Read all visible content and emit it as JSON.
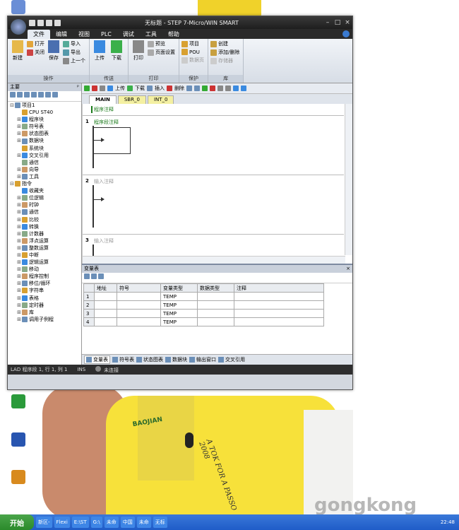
{
  "window": {
    "title": "无标题 - STEP 7-Micro/WIN SMART"
  },
  "menu": [
    "文件",
    "编辑",
    "视图",
    "PLC",
    "调试",
    "工具",
    "帮助"
  ],
  "ribbon": {
    "groups": [
      {
        "label": "操作",
        "big": [
          {
            "label": "新建",
            "icon": "new-icon"
          }
        ],
        "small": [
          {
            "label": "打开"
          },
          {
            "label": "关闭"
          }
        ],
        "big2": [
          {
            "label": "保存"
          }
        ],
        "small2": [
          {
            "label": "导入"
          },
          {
            "label": "导出"
          },
          {
            "label": "上一个"
          }
        ]
      },
      {
        "label": "传送",
        "big": [
          {
            "label": "上传"
          },
          {
            "label": "下载"
          }
        ]
      },
      {
        "label": "打印",
        "big": [
          {
            "label": "打印"
          }
        ],
        "small": [
          {
            "label": "预览"
          },
          {
            "label": "页面设置"
          }
        ]
      },
      {
        "label": "保护",
        "small": [
          {
            "label": "项目"
          },
          {
            "label": "POU"
          },
          {
            "label": "数据页"
          }
        ]
      },
      {
        "label": "库",
        "small": [
          {
            "label": "创建"
          },
          {
            "label": "添加/删除"
          },
          {
            "label": "存储器"
          }
        ]
      }
    ]
  },
  "nav": {
    "title": "主要",
    "tree": [
      {
        "label": "项目1",
        "level": 0,
        "exp": "-"
      },
      {
        "label": "CPU ST40",
        "level": 1,
        "exp": ""
      },
      {
        "label": "程序块",
        "level": 1,
        "exp": "+"
      },
      {
        "label": "符号表",
        "level": 1,
        "exp": "+"
      },
      {
        "label": "状态图表",
        "level": 1,
        "exp": "+"
      },
      {
        "label": "数据块",
        "level": 1,
        "exp": "+"
      },
      {
        "label": "系统块",
        "level": 1,
        "exp": ""
      },
      {
        "label": "交叉引用",
        "level": 1,
        "exp": "+"
      },
      {
        "label": "通信",
        "level": 1,
        "exp": ""
      },
      {
        "label": "向导",
        "level": 1,
        "exp": "+"
      },
      {
        "label": "工具",
        "level": 1,
        "exp": "+"
      },
      {
        "label": "指令",
        "level": 0,
        "exp": "-"
      },
      {
        "label": "收藏夹",
        "level": 1,
        "exp": ""
      },
      {
        "label": "位逻辑",
        "level": 1,
        "exp": "+"
      },
      {
        "label": "时钟",
        "level": 1,
        "exp": "+"
      },
      {
        "label": "通信",
        "level": 1,
        "exp": "+"
      },
      {
        "label": "比较",
        "level": 1,
        "exp": "+"
      },
      {
        "label": "转换",
        "level": 1,
        "exp": "+"
      },
      {
        "label": "计数器",
        "level": 1,
        "exp": "+"
      },
      {
        "label": "浮点运算",
        "level": 1,
        "exp": "+"
      },
      {
        "label": "整数运算",
        "level": 1,
        "exp": "+"
      },
      {
        "label": "中断",
        "level": 1,
        "exp": "+"
      },
      {
        "label": "逻辑运算",
        "level": 1,
        "exp": "+"
      },
      {
        "label": "移动",
        "level": 1,
        "exp": "+"
      },
      {
        "label": "程序控制",
        "level": 1,
        "exp": "+"
      },
      {
        "label": "移位/循环",
        "level": 1,
        "exp": "+"
      },
      {
        "label": "字符串",
        "level": 1,
        "exp": "+"
      },
      {
        "label": "表格",
        "level": 1,
        "exp": "+"
      },
      {
        "label": "定时器",
        "level": 1,
        "exp": "+"
      },
      {
        "label": "库",
        "level": 1,
        "exp": "+"
      },
      {
        "label": "调用子例程",
        "level": 1,
        "exp": "+"
      }
    ]
  },
  "editor": {
    "toolbar": [
      "上传",
      "下载",
      "插入",
      "删除"
    ],
    "tabs": [
      "MAIN",
      "SBR_0",
      "INT_0"
    ],
    "program_comment": "程序注释",
    "networks": [
      {
        "num": "1",
        "comment": "程序段注释"
      },
      {
        "num": "2",
        "comment": "输入注释"
      },
      {
        "num": "3",
        "comment": "输入注释"
      }
    ]
  },
  "vartable": {
    "title": "变量表",
    "headers": [
      "地址",
      "符号",
      "变量类型",
      "数据类型",
      "注释"
    ],
    "rows": [
      {
        "n": "1",
        "type": "TEMP"
      },
      {
        "n": "2",
        "type": "TEMP"
      },
      {
        "n": "3",
        "type": "TEMP"
      },
      {
        "n": "4",
        "type": "TEMP"
      }
    ],
    "bottom_tabs": [
      "变量表",
      "符号表",
      "状态图表",
      "数据块",
      "输出窗口",
      "交叉引用"
    ]
  },
  "status": {
    "pos": "LAD 程序段 1, 行 1, 列 1",
    "mode": "INS",
    "conn": "未连接"
  },
  "taskbar": {
    "start": "开始",
    "items": [
      "新区-",
      "Flexi",
      "E:\\ST",
      "G:\\",
      "未命",
      "中国",
      "未命",
      "无标"
    ],
    "clock": "22:48"
  },
  "desktop": {
    "icons": [
      "",
      "",
      "",
      ""
    ],
    "watermark": "gongkong"
  },
  "background": {
    "logo": "BAOJIAN",
    "slogan": "A TOK FOR A PASSO 2008"
  }
}
